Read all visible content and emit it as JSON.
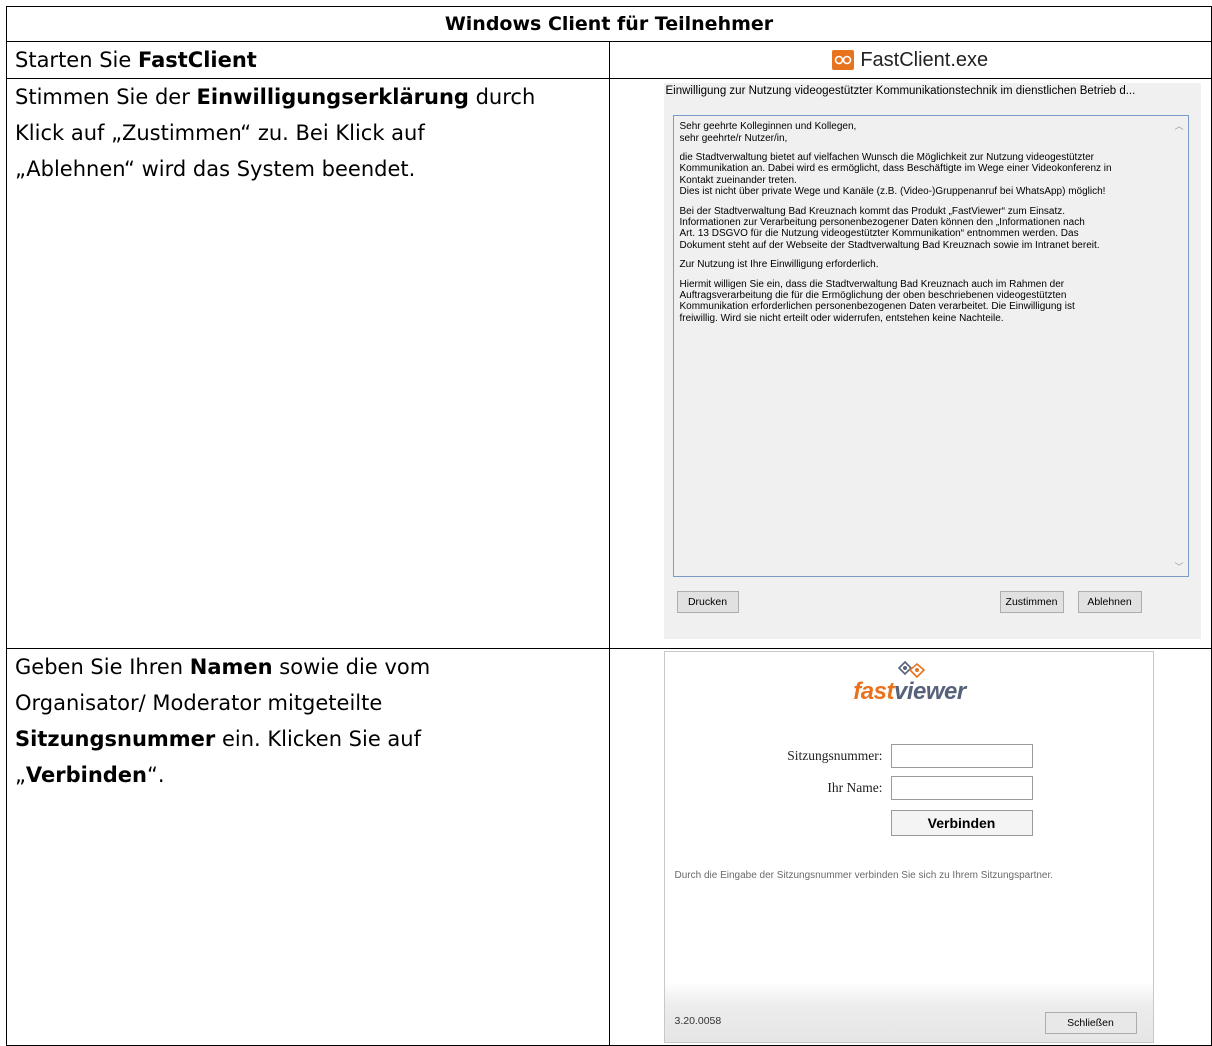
{
  "table": {
    "title": "Windows Client für Teilnehmer"
  },
  "step1": {
    "text_pre": "Starten Sie ",
    "text_bold": "FastClient",
    "exe_label": "FastClient.exe",
    "exe_icon": "fastviewer-logo-icon"
  },
  "step2": {
    "text_pre": "Stimmen Sie der ",
    "text_bold": "Einwilligungserklärung",
    "text_post": " durch\nKlick auf „Zustimmen“ zu. Bei Klick auf\n„Ablehnen“ wird das System beendet.",
    "window": {
      "title": "Einwilligung zur Nutzung videogestützter Kommunikationstechnik im dienstlichen Betrieb d...",
      "paragraphs": [
        "Sehr geehrte Kolleginnen und Kollegen,\nsehr geehrte/r Nutzer/in,",
        "die Stadtverwaltung bietet auf vielfachen Wunsch die Möglichkeit zur Nutzung videogestützter\nKommunikation an. Dabei wird es ermöglicht, dass Beschäftigte im Wege einer Videokonferenz in\nKontakt zueinander treten.\nDies ist nicht über private Wege und Kanäle (z.B. (Video-)Gruppenanruf bei WhatsApp) möglich!",
        "Bei der Stadtverwaltung Bad Kreuznach kommt das Produkt „FastViewer“ zum Einsatz.\nInformationen zur Verarbeitung personenbezogener Daten können den „Informationen nach\nArt. 13 DSGVO für die Nutzung videogestützter Kommunikation“ entnommen werden. Das\nDokument steht auf der Webseite der Stadtverwaltung Bad Kreuznach sowie im Intranet bereit.",
        "Zur Nutzung ist Ihre Einwilligung erforderlich.",
        "Hiermit willigen Sie ein, dass die Stadtverwaltung Bad Kreuznach auch im Rahmen der\nAuftragsverarbeitung die für die Ermöglichung der oben beschriebenen videogestützten\nKommunikation erforderlichen personenbezogenen Daten verarbeitet. Die Einwilligung ist\nfreiwillig. Wird sie nicht erteilt oder widerrufen, entstehen keine Nachteile."
      ],
      "btn_print": "Drucken",
      "btn_agree": "Zustimmen",
      "btn_decline": "Ablehnen"
    }
  },
  "step3": {
    "text_a": "Geben Sie Ihren ",
    "text_b": "Namen",
    "text_c": " sowie die vom\nOrganisator/ Moderator mitgeteilte\n",
    "text_d": "Sitzungsnummer",
    "text_e": " ein. Klicken Sie auf\n„",
    "text_f": "Verbinden",
    "text_g": "“.",
    "window": {
      "logo_fast": "fast",
      "logo_viewer": "viewer",
      "session_label": "Sitzungsnummer:",
      "session_value": "",
      "name_label": "Ihr Name:",
      "name_value": "",
      "btn_connect": "Verbinden",
      "hint": "Durch die Eingabe der Sitzungsnummer verbinden Sie sich zu Ihrem Sitzungspartner.",
      "version": "3.20.0058",
      "btn_close": "Schließen"
    }
  },
  "colors": {
    "brand_orange": "#e8731f",
    "brand_slate": "#56627a"
  }
}
